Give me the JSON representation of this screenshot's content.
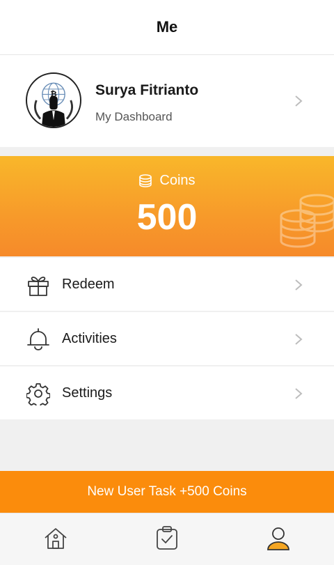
{
  "header": {
    "title": "Me"
  },
  "profile": {
    "name": "Surya Fitrianto",
    "subtitle": "My Dashboard",
    "avatar_icon": "anonymous-bitcoin-avatar"
  },
  "coins": {
    "label": "Coins",
    "amount": "500",
    "icon": "coins-icon"
  },
  "menu": [
    {
      "label": "Redeem",
      "icon": "gift-icon"
    },
    {
      "label": "Activities",
      "icon": "bell-icon"
    },
    {
      "label": "Settings",
      "icon": "gear-icon"
    }
  ],
  "banner": {
    "label": "New User Task +500 Coins"
  },
  "tabbar": [
    {
      "icon": "home-icon",
      "active": false
    },
    {
      "icon": "task-icon",
      "active": false
    },
    {
      "icon": "profile-icon",
      "active": true
    }
  ],
  "colors": {
    "accent": "#fb8c0c",
    "coins_gradient_top": "#f9b72a",
    "coins_gradient_bottom": "#f68a2a",
    "active_tab": "#f5a623"
  }
}
